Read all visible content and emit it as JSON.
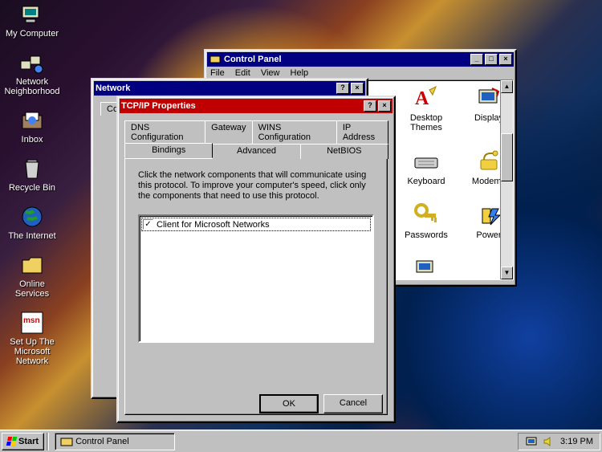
{
  "desktop_icons": [
    {
      "label": "My Computer"
    },
    {
      "label": "Network Neighborhood"
    },
    {
      "label": "Inbox"
    },
    {
      "label": "Recycle Bin"
    },
    {
      "label": "The Internet"
    },
    {
      "label": "Online Services"
    },
    {
      "label": "Set Up The Microsoft Network"
    }
  ],
  "control_panel": {
    "title": "Control Panel",
    "menu": {
      "file": "File",
      "edit": "Edit",
      "view": "View",
      "help": "Help"
    },
    "items": [
      {
        "label": "Desktop Themes"
      },
      {
        "label": "Display"
      },
      {
        "label": "Keyboard"
      },
      {
        "label": "Modems"
      },
      {
        "label": "Passwords"
      },
      {
        "label": "Power"
      },
      {
        "label": ""
      }
    ]
  },
  "network_window": {
    "title": "Network",
    "visible_tab_fragment": "Co"
  },
  "tcpip_dialog": {
    "title": "TCP/IP Properties",
    "tabs_row1": [
      "DNS Configuration",
      "Gateway",
      "WINS Configuration",
      "IP Address"
    ],
    "tabs_row2": [
      "Bindings",
      "Advanced",
      "NetBIOS"
    ],
    "active_tab": "Bindings",
    "instructions": "Click the network components that will communicate using this protocol. To improve your computer's speed, click only the components that need to use this protocol.",
    "binding_items": [
      {
        "checked": true,
        "label": "Client for Microsoft Networks"
      }
    ],
    "ok_label": "OK",
    "cancel_label": "Cancel"
  },
  "taskbar": {
    "start_label": "Start",
    "task_button": "Control Panel",
    "clock": "3:19 PM"
  }
}
